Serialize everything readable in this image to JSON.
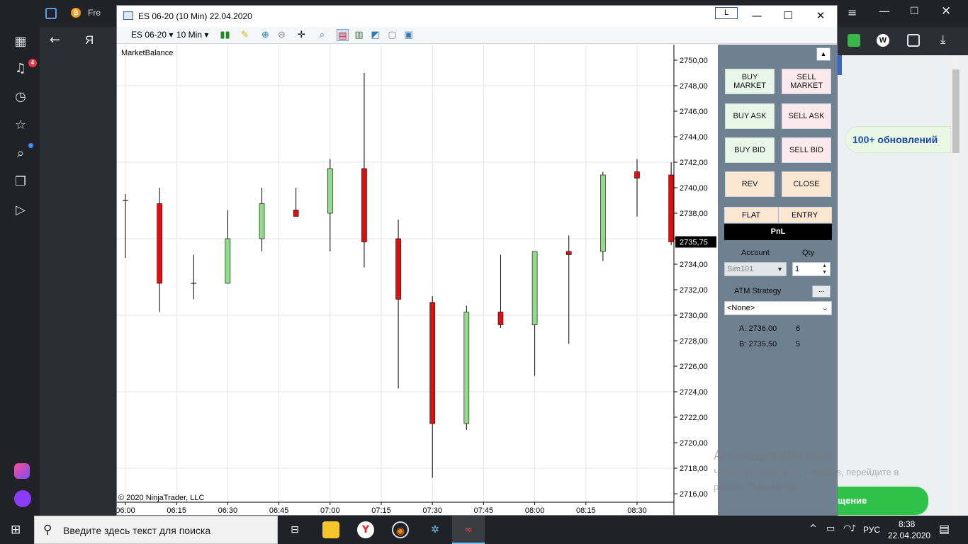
{
  "browser": {
    "tab_label": "Fre",
    "nav_letter": "Я",
    "notification_count": "4"
  },
  "web_page": {
    "update_pill": "100+ обновлений",
    "green_button": "щение"
  },
  "watermark": {
    "title": "Активация Windows",
    "line1": "Чтобы активировать Windows, перейдите в",
    "line2": "раздел \"Параметры\"."
  },
  "ninja": {
    "title": "ES 06-20 (10 Min)  22.04.2020",
    "L_button": "L",
    "toolbar": {
      "instrument": "ES 06-20",
      "interval": "10 Min"
    },
    "chart_label": "MarketBalance",
    "copyright": "© 2020 NinjaTrader, LLC",
    "current_price": "2735,75"
  },
  "trader": {
    "buy_market": "BUY MARKET",
    "sell_market": "SELL MARKET",
    "buy_ask": "BUY ASK",
    "sell_ask": "SELL ASK",
    "buy_bid": "BUY BID",
    "sell_bid": "SELL BID",
    "rev": "REV",
    "close": "CLOSE",
    "flat": "FLAT",
    "entry": "ENTRY",
    "pnl": "PnL",
    "account_label": "Account",
    "qty_label": "Qty",
    "account_value": "Sim101",
    "qty_value": "1",
    "atm_label": "ATM Strategy",
    "atm_button": "...",
    "atm_value": "<None>",
    "ask_label": "A: 2736,00",
    "ask_size": "6",
    "bid_label": "B: 2735,50",
    "bid_size": "5"
  },
  "taskbar": {
    "search_placeholder": "Введите здесь текст для поиска",
    "lang": "РУС",
    "time": "8:38",
    "date": "22.04.2020"
  },
  "chart_data": {
    "type": "candlestick",
    "ylim": [
      2715,
      2751
    ],
    "y_ticks": [
      "2750,00",
      "2748,00",
      "2746,00",
      "2744,00",
      "2742,00",
      "2740,00",
      "2738,00",
      "2736,00",
      "2734,00",
      "2732,00",
      "2730,00",
      "2728,00",
      "2726,00",
      "2724,00",
      "2722,00",
      "2720,00",
      "2718,00",
      "2716,00"
    ],
    "x_ticks": [
      "06:00",
      "06:15",
      "06:30",
      "06:45",
      "07:00",
      "07:15",
      "07:30",
      "07:45",
      "08:00",
      "08:15",
      "08:30"
    ],
    "candles": [
      {
        "time": "06:00",
        "open": 2739.0,
        "high": 2739.5,
        "low": 2734.5,
        "close": 2739.0
      },
      {
        "time": "06:10",
        "open": 2738.75,
        "high": 2740.0,
        "low": 2730.25,
        "close": 2732.5
      },
      {
        "time": "06:20",
        "open": 2732.5,
        "high": 2734.75,
        "low": 2731.25,
        "close": 2732.5
      },
      {
        "time": "06:30",
        "open": 2732.5,
        "high": 2738.25,
        "low": 2732.5,
        "close": 2736.0
      },
      {
        "time": "06:40",
        "open": 2736.0,
        "high": 2740.0,
        "low": 2735.0,
        "close": 2738.75
      },
      {
        "time": "06:50",
        "open": 2738.25,
        "high": 2740.0,
        "low": 2737.75,
        "close": 2737.75
      },
      {
        "time": "07:00",
        "open": 2738.0,
        "high": 2742.25,
        "low": 2735.0,
        "close": 2741.5
      },
      {
        "time": "07:10",
        "open": 2741.5,
        "high": 2749.0,
        "low": 2733.75,
        "close": 2735.75
      },
      {
        "time": "07:20",
        "open": 2736.0,
        "high": 2737.5,
        "low": 2724.25,
        "close": 2731.25
      },
      {
        "time": "07:30",
        "open": 2731.0,
        "high": 2731.5,
        "low": 2717.25,
        "close": 2721.5
      },
      {
        "time": "07:40",
        "open": 2721.5,
        "high": 2730.75,
        "low": 2721.0,
        "close": 2730.25
      },
      {
        "time": "07:50",
        "open": 2730.25,
        "high": 2734.75,
        "low": 2729.0,
        "close": 2729.25
      },
      {
        "time": "08:00",
        "open": 2729.25,
        "high": 2735.0,
        "low": 2725.25,
        "close": 2735.0
      },
      {
        "time": "08:10",
        "open": 2735.0,
        "high": 2736.25,
        "low": 2727.75,
        "close": 2734.75
      },
      {
        "time": "08:20",
        "open": 2735.0,
        "high": 2741.25,
        "low": 2734.25,
        "close": 2741.0
      },
      {
        "time": "08:30",
        "open": 2741.25,
        "high": 2742.25,
        "low": 2737.75,
        "close": 2740.75
      },
      {
        "time": "08:40",
        "open": 2741.0,
        "high": 2742.0,
        "low": 2735.5,
        "close": 2735.75
      }
    ],
    "up_color": "#8fdc8a",
    "down_color": "#e30d0d",
    "grid": true,
    "current_price": 2735.75
  }
}
